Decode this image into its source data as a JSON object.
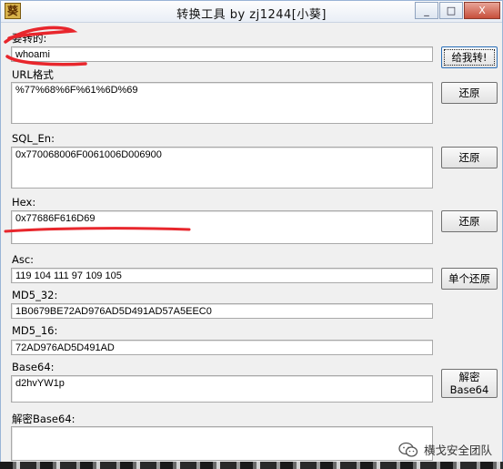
{
  "window": {
    "title": "转换工具 by zj1244[小葵]",
    "icon_char": "葵",
    "controls": {
      "minimize": "_",
      "maximize": "□",
      "close": "X"
    }
  },
  "fields": {
    "input": {
      "label": "要转的:",
      "value": "whoami",
      "button": "给我转!"
    },
    "url": {
      "label": "URL格式",
      "value": "%77%68%6F%61%6D%69",
      "button": "还原"
    },
    "sql": {
      "label": "SQL_En:",
      "value": "0x770068006F0061006D006900",
      "button": "还原"
    },
    "hex": {
      "label": "Hex:",
      "value": "0x77686F616D69",
      "button": "还原"
    },
    "asc": {
      "label": "Asc:",
      "value": "119 104 111 97 109 105",
      "button": "单个还原"
    },
    "md5_32": {
      "label": "MD5_32:",
      "value": "1B0679BE72AD976AD5D491AD57A5EEC0"
    },
    "md5_16": {
      "label": "MD5_16:",
      "value": "72AD976AD5D491AD"
    },
    "base64": {
      "label": "Base64:",
      "value": "d2hvYW1p",
      "button_line1": "解密",
      "button_line2": "Base64"
    },
    "decode_base64": {
      "label": "解密Base64:",
      "value": ""
    }
  },
  "watermark": {
    "text": "横戈安全团队",
    "icon": "wechat-icon"
  },
  "colors": {
    "annotation": "#e8262c",
    "close_button": "#c7503b"
  }
}
